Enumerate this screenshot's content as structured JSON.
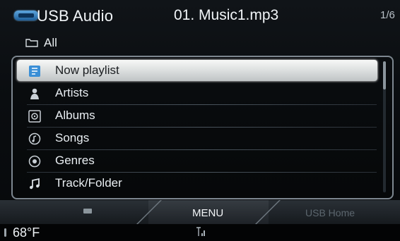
{
  "header": {
    "source_label": "USB Audio",
    "track_title": "01. Music1.mp3",
    "page_indicator": "1/6"
  },
  "category": {
    "label": "All",
    "icon": "folder-icon"
  },
  "list": {
    "items": [
      {
        "label": "Now playlist",
        "icon": "playlist-icon",
        "selected": true
      },
      {
        "label": "Artists",
        "icon": "artist-icon",
        "selected": false
      },
      {
        "label": "Albums",
        "icon": "album-icon",
        "selected": false
      },
      {
        "label": "Songs",
        "icon": "song-icon",
        "selected": false
      },
      {
        "label": "Genres",
        "icon": "genre-icon",
        "selected": false
      },
      {
        "label": "Track/Folder",
        "icon": "music-note-icon",
        "selected": false
      }
    ]
  },
  "softkeys": {
    "menu_label": "MENU",
    "usb_home_label": "USB Home"
  },
  "status": {
    "temperature": "68°F"
  },
  "colors": {
    "accent_blue": "#3b8fd6",
    "selected_bg": "#e6e8e8",
    "panel_border": "#7d8790"
  }
}
